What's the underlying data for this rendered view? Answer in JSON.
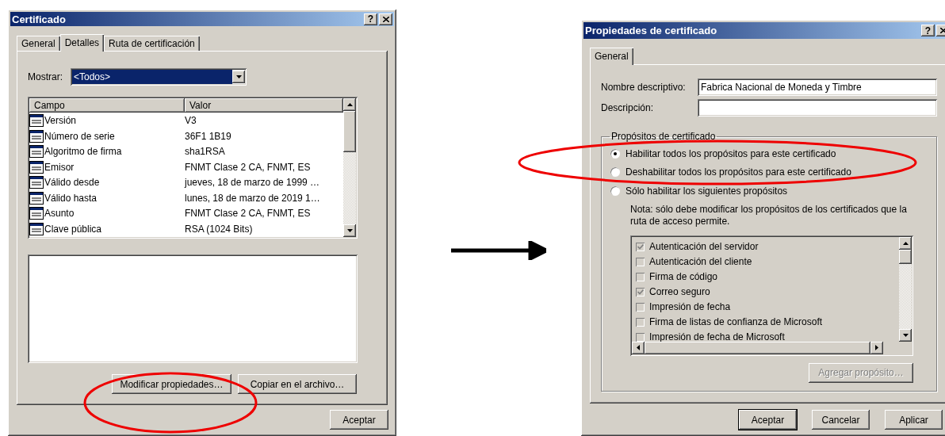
{
  "left_dialog": {
    "title": "Certificado",
    "help_button": "?",
    "tabs": [
      {
        "label": "General",
        "selected": false
      },
      {
        "label": "Detalles",
        "selected": true
      },
      {
        "label": "Ruta de certificación",
        "selected": false
      }
    ],
    "show": {
      "label": "Mostrar:",
      "value": "<Todos>"
    },
    "table": {
      "columns": [
        "Campo",
        "Valor"
      ],
      "rows": [
        {
          "field": "Versión",
          "value": "V3"
        },
        {
          "field": "Número de serie",
          "value": "36F1 1B19"
        },
        {
          "field": "Algoritmo de firma",
          "value": "sha1RSA"
        },
        {
          "field": "Emisor",
          "value": "FNMT Clase 2 CA, FNMT, ES"
        },
        {
          "field": "Válido desde",
          "value": "jueves, 18 de marzo de 1999 …"
        },
        {
          "field": "Válido hasta",
          "value": "lunes, 18 de marzo de 2019 1…"
        },
        {
          "field": "Asunto",
          "value": "FNMT Clase 2 CA, FNMT, ES"
        },
        {
          "field": "Clave pública",
          "value": "RSA (1024 Bits)"
        }
      ]
    },
    "buttons": [
      "Modificar propiedades…",
      "Copiar en el archivo…"
    ],
    "footer_buttons": [
      "Aceptar"
    ]
  },
  "right_dialog": {
    "title": "Propiedades de certificado",
    "help_button": "?",
    "tabs": [
      {
        "label": "General",
        "selected": true
      }
    ],
    "fields": [
      {
        "label": "Nombre descriptivo:",
        "value": "Fabrica Nacional de Moneda y Timbre"
      },
      {
        "label": "Descripción:"
      }
    ],
    "purposes": {
      "legend": "Propósitos de certificado",
      "options": [
        {
          "label": "Habilitar todos los propósitos para este certificado",
          "selected": true
        },
        {
          "label": "Deshabilitar todos los propósitos para este certificado",
          "selected": false
        },
        {
          "label": "Sólo habilitar los siguientes propósitos",
          "selected": false
        }
      ],
      "note": "Nota: sólo debe modificar los propósitos de los certificados que la ruta de acceso permite.",
      "items": [
        {
          "label": "Autenticación del servidor",
          "checked": true
        },
        {
          "label": "Autenticación del cliente",
          "checked": false
        },
        {
          "label": "Firma de código",
          "checked": false
        },
        {
          "label": "Correo seguro",
          "checked": true
        },
        {
          "label": "Impresión de fecha",
          "checked": false
        },
        {
          "label": "Firma de listas de confianza de Microsoft",
          "checked": false
        },
        {
          "label": "Impresión de fecha de Microsoft",
          "checked": false
        }
      ],
      "add_button": {
        "label": "Agregar propósito…",
        "disabled": true
      }
    },
    "footer_buttons": [
      "Aceptar",
      "Cancelar",
      "Aplicar"
    ]
  }
}
